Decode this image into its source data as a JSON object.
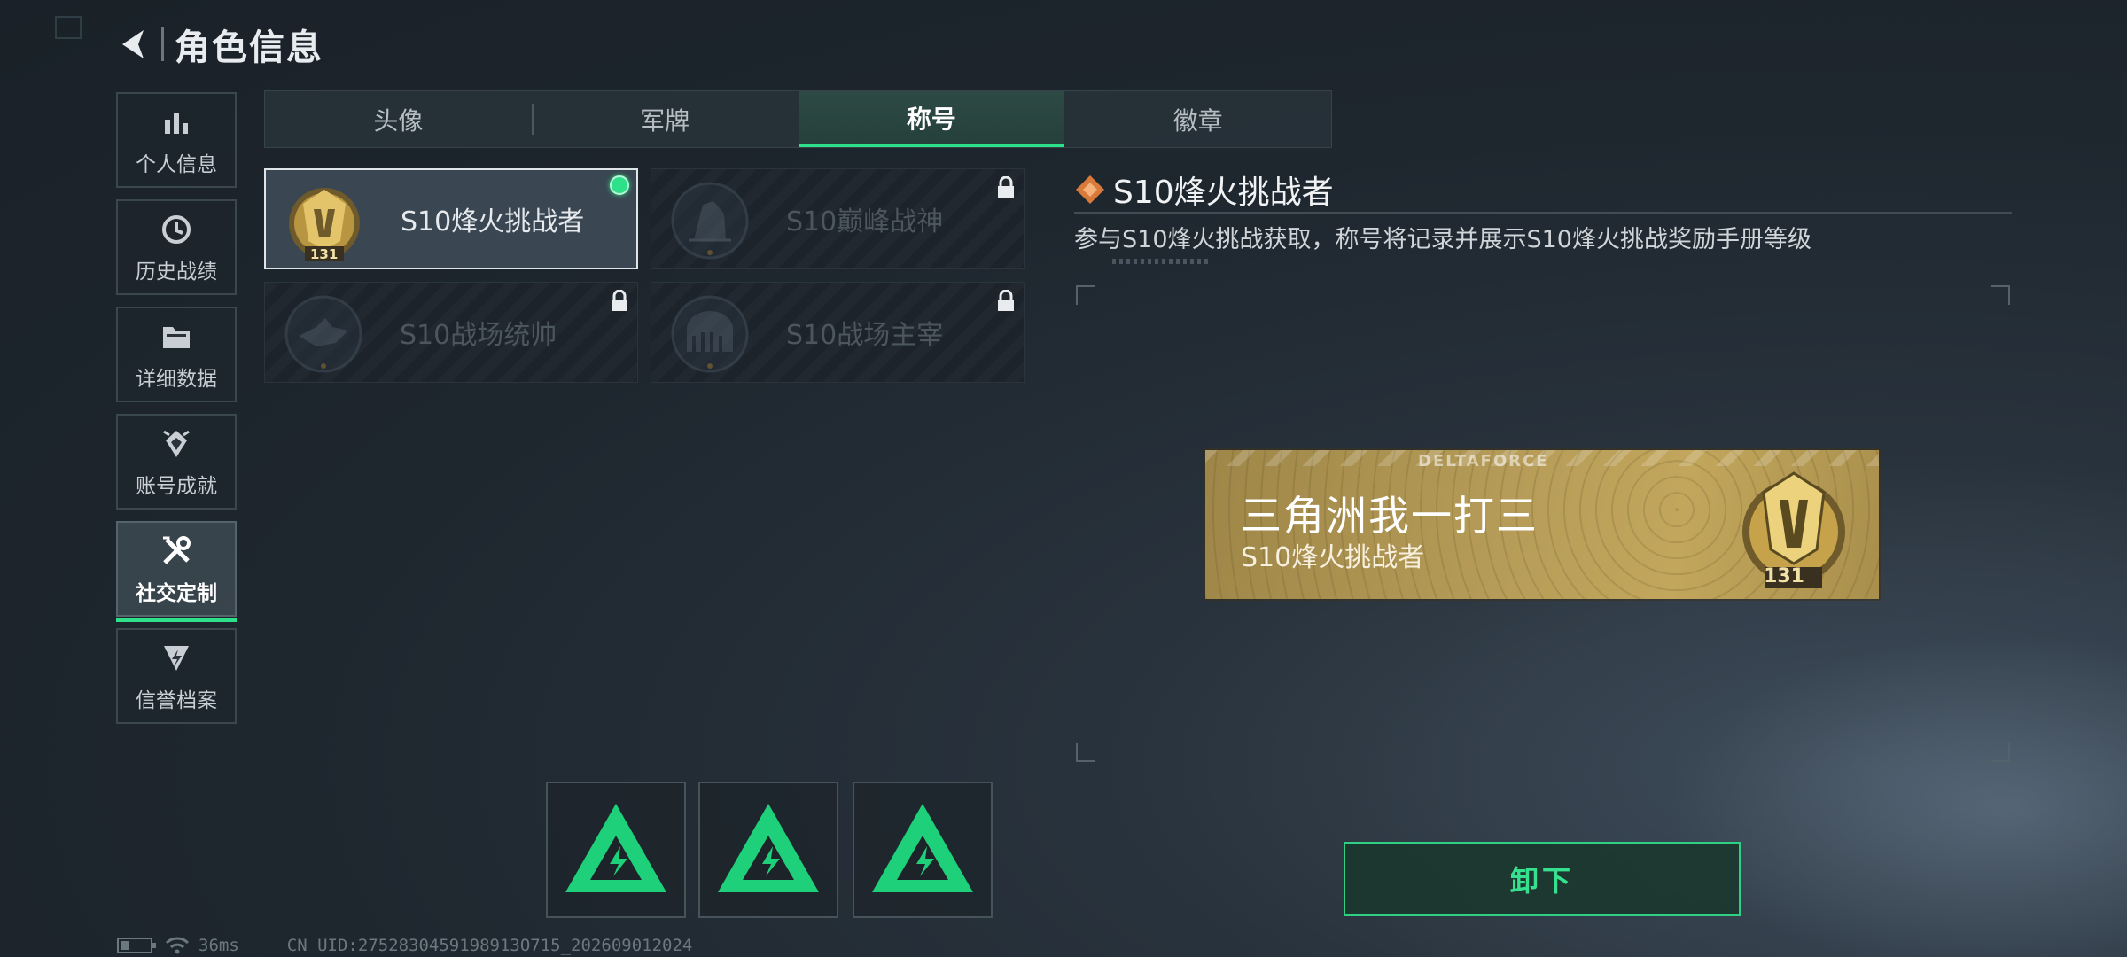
{
  "header": {
    "title": "角色信息",
    "back_icon": "back-arrow-icon"
  },
  "sidenav": {
    "items": [
      {
        "label": "个人信息",
        "icon": "bar-chart-icon"
      },
      {
        "label": "历史战绩",
        "icon": "clock-icon"
      },
      {
        "label": "详细数据",
        "icon": "folder-icon"
      },
      {
        "label": "账号成就",
        "icon": "achievement-icon"
      },
      {
        "label": "社交定制",
        "icon": "tools-icon",
        "active": true
      },
      {
        "label": "信誉档案",
        "icon": "credit-shield-icon"
      }
    ]
  },
  "tabs": [
    {
      "label": "头像"
    },
    {
      "label": "军牌"
    },
    {
      "label": "称号",
      "active": true
    },
    {
      "label": "徽章"
    }
  ],
  "titles": [
    {
      "label": "S10烽火挑战者",
      "badge_level": "131",
      "selected": true,
      "equipped": true,
      "locked": false
    },
    {
      "label": "S10巅峰战神",
      "locked": true
    },
    {
      "label": "S10战场统帅",
      "locked": true
    },
    {
      "label": "S10战场主宰",
      "locked": true
    }
  ],
  "detail": {
    "title": "S10烽火挑战者",
    "description": "参与S10烽火挑战获取，称号将记录并展示S10烽火挑战奖励手册等级"
  },
  "nameplate": {
    "brand": "DELTAFORCE",
    "player_name": "三角洲我一打三",
    "title": "S10烽火挑战者",
    "badge_level": "131"
  },
  "unequip_button": {
    "label": "卸下"
  },
  "status": {
    "ping": "36ms",
    "uid": "CN UID:2752830459198913O715_202609012024"
  },
  "colors": {
    "accent_green": "#2fe08a",
    "gold": "#c2a65c",
    "panel_bg": "#1c232a"
  }
}
